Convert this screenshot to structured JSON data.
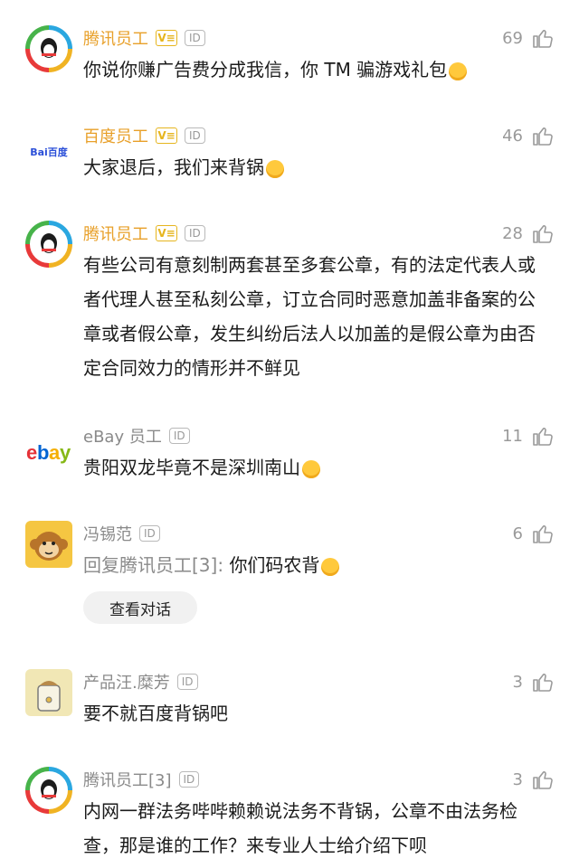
{
  "comments": [
    {
      "user": "腾讯员工",
      "badge_v": "V≡",
      "badge_id": "ID",
      "likes": "69",
      "text": "你说你赚广告费分成我信，你 TM 骗游戏礼包"
    },
    {
      "user": "百度员工",
      "badge_v": "V≡",
      "badge_id": "ID",
      "likes": "46",
      "text": "大家退后，我们来背锅",
      "avatar_text": "Bai百度"
    },
    {
      "user": "腾讯员工",
      "badge_v": "V≡",
      "badge_id": "ID",
      "likes": "28",
      "text": "有些公司有意刻制两套甚至多套公章，有的法定代表人或者代理人甚至私刻公章，订立合同时恶意加盖非备案的公章或者假公章，发生纠纷后法人以加盖的是假公章为由否定合同效力的情形并不鲜见"
    },
    {
      "user": "eBay 员工",
      "badge_id": "ID",
      "likes": "11",
      "text": "贵阳双龙毕竟不是深圳南山",
      "avatar_text": "ebay"
    },
    {
      "user": "冯锡范",
      "badge_id": "ID",
      "likes": "6",
      "reply_prefix": "回复腾讯员工[3]:",
      "text": "你们码农背",
      "view_dialog": "查看对话"
    },
    {
      "user": "产品汪.糜芳",
      "badge_id": "ID",
      "likes": "3",
      "text": "要不就百度背锅吧"
    },
    {
      "user": "腾讯员工[3]",
      "badge_id": "ID",
      "likes": "3",
      "text": "内网一群法务哔哔赖赖说法务不背锅，公章不由法务检查，那是谁的工作？来专业人士给介绍下呗"
    }
  ],
  "colors": {
    "username": "#e8a02a",
    "muted": "#8a8a8a",
    "vbadge": "#e6b51e"
  }
}
